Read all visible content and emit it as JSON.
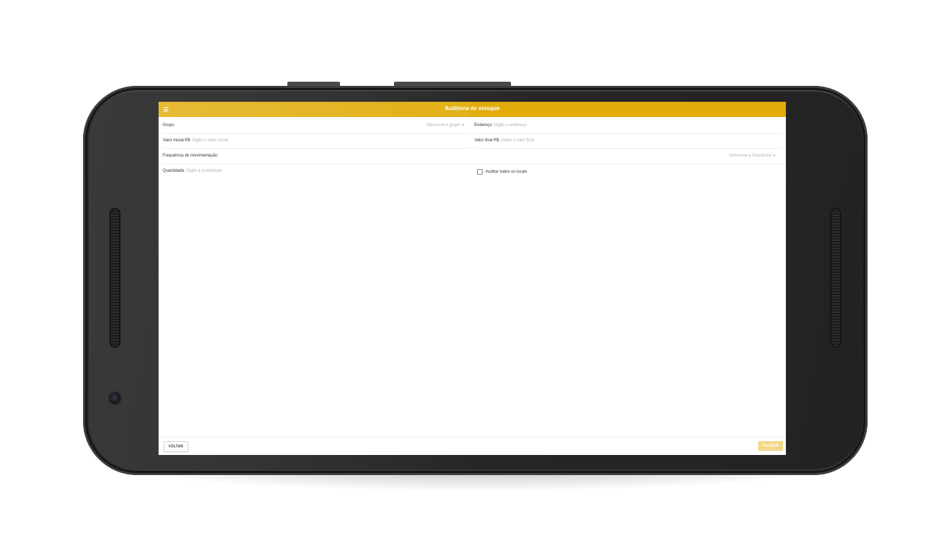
{
  "app": {
    "title": "Auditoria de estoque",
    "accent_color": "#e1ac0b",
    "menu_icon": "hamburger-menu-icon"
  },
  "form": {
    "grupo": {
      "label": "Grupo",
      "placeholder": "Selecione o grupo"
    },
    "endereco": {
      "label": "Endereço",
      "placeholder": "Digite o endereço"
    },
    "valor_inicial": {
      "label": "Valor inicial R$",
      "placeholder": "Digite o valor inicial"
    },
    "valor_final": {
      "label": "Valor final R$",
      "placeholder": "Digite o valor final"
    },
    "frequencia": {
      "label": "Frequência de movimentação",
      "placeholder": "Selecione a frequência"
    },
    "quantidade": {
      "label": "Quantidade",
      "placeholder": "Digite a quantidade"
    },
    "auditar_todos": {
      "label": "Auditar todos os locais",
      "checked": false
    }
  },
  "footer": {
    "back_label": "VOLTAR",
    "filter_label": "FILTRAR"
  }
}
